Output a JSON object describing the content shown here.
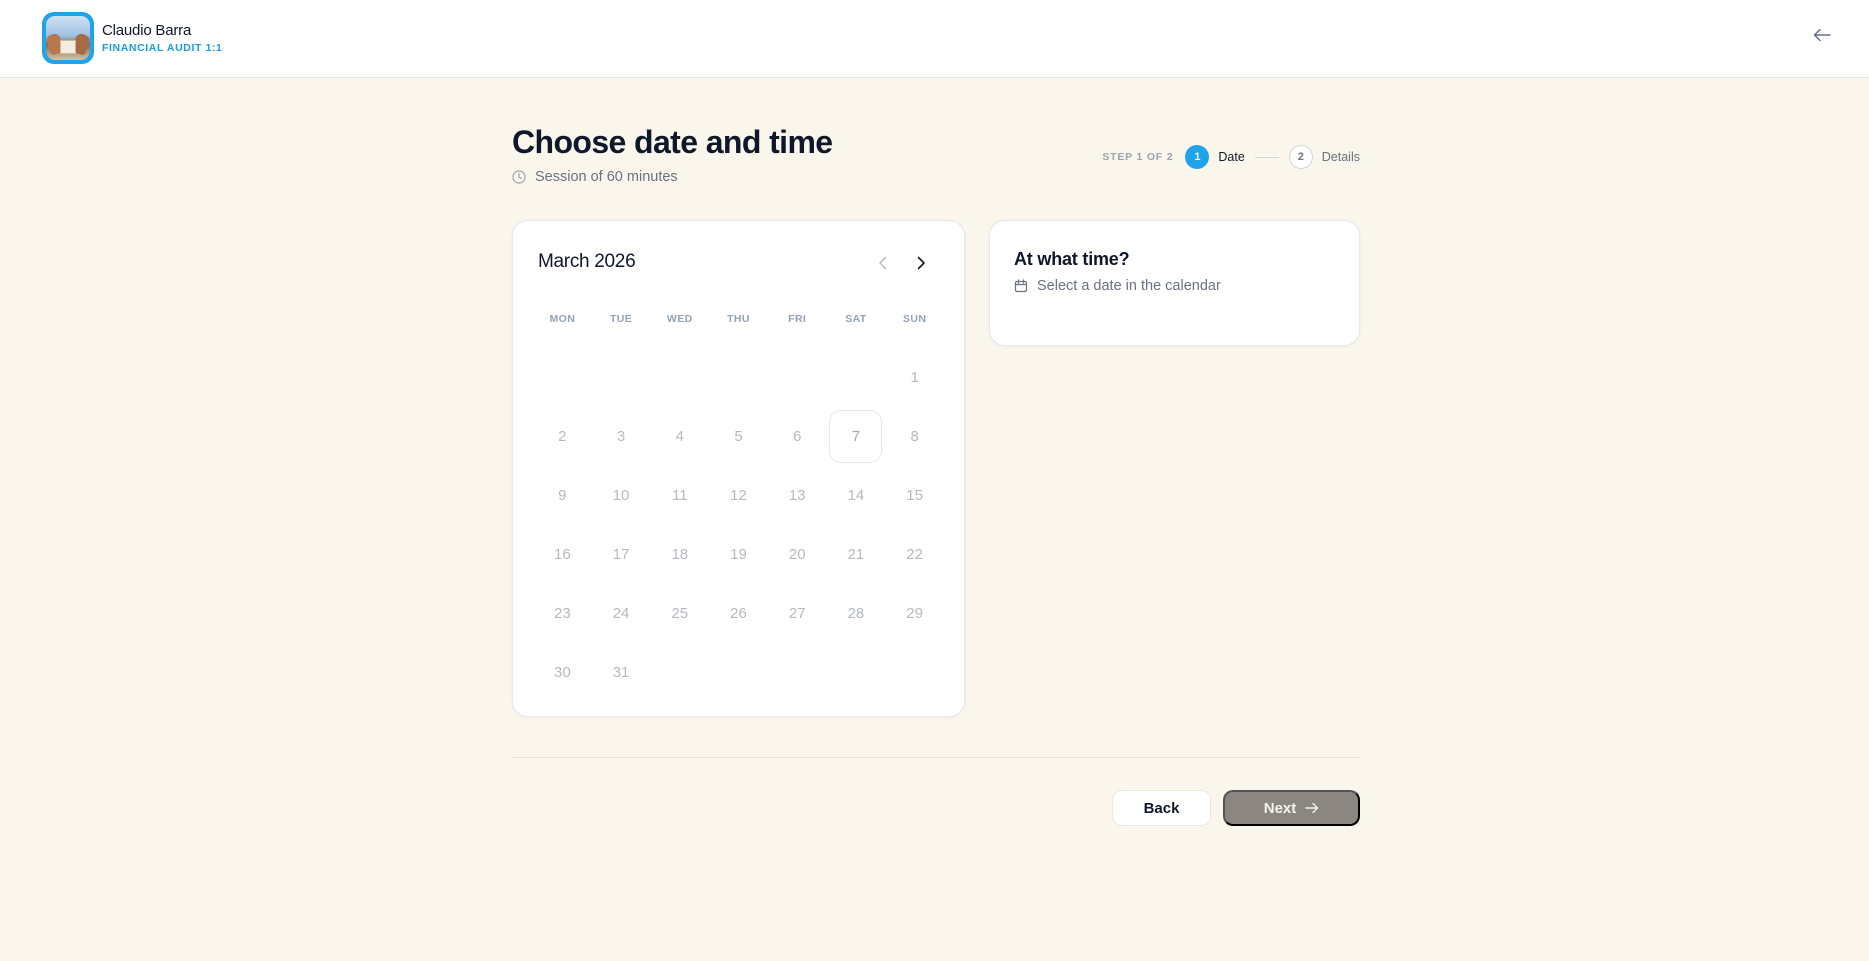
{
  "header": {
    "user_name": "Claudio Barra",
    "user_role": "FINANCIAL AUDIT 1:1",
    "back_icon": "arrow-left-icon"
  },
  "page": {
    "title": "Choose date and time",
    "subtitle": "Session of 60 minutes",
    "subtitle_icon": "clock-icon"
  },
  "stepper": {
    "count_label": "STEP 1 OF 2",
    "steps": [
      {
        "number": "1",
        "label": "Date",
        "state": "active"
      },
      {
        "number": "2",
        "label": "Details",
        "state": "inactive"
      }
    ],
    "active_color": "#1fa3ea"
  },
  "calendar": {
    "month_label": "March 2026",
    "weekdays": [
      "MON",
      "TUE",
      "WED",
      "THU",
      "FRI",
      "SAT",
      "SUN"
    ],
    "days": [
      "",
      "",
      "",
      "",
      "",
      "",
      "1",
      "2",
      "3",
      "4",
      "5",
      "6",
      "7",
      "8",
      "9",
      "10",
      "11",
      "12",
      "13",
      "14",
      "15",
      "16",
      "17",
      "18",
      "19",
      "20",
      "21",
      "22",
      "23",
      "24",
      "25",
      "26",
      "27",
      "28",
      "29",
      "30",
      "31"
    ],
    "today": "7"
  },
  "time_panel": {
    "title": "At what time?",
    "hint": "Select a date in the calendar",
    "hint_icon": "calendar-icon"
  },
  "footer": {
    "back_label": "Back",
    "next_label": "Next",
    "next_disabled": true
  }
}
